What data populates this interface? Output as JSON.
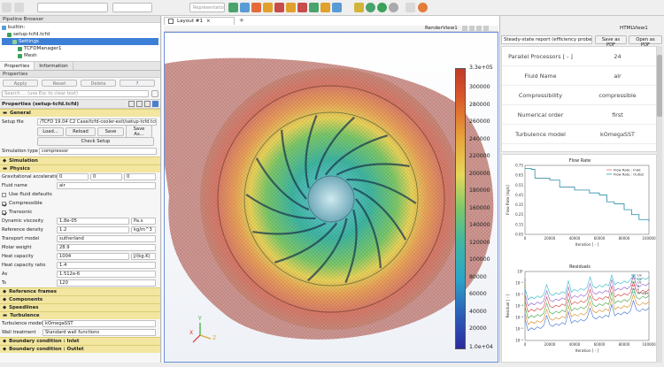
{
  "toolbar": {
    "representation_placeholder": "Representation",
    "icons": [
      "reset-camera-icon",
      "zoom-icon",
      "rotate-icon",
      "axes-icon",
      "camera-icon",
      "filter-icon",
      "slice-icon",
      "clip-icon",
      "glyph-icon",
      "threshold-icon",
      "play-icon",
      "record-icon",
      "settings-icon",
      "python-icon"
    ]
  },
  "pipeline": {
    "title": "Pipeline Browser",
    "items": [
      "builtin:",
      "setup-tcfd.tcfd",
      "Settings",
      "TCFDManager1",
      "Mesh"
    ]
  },
  "properties_panel": {
    "tabs": [
      "Properties",
      "Information"
    ],
    "header": "Properties",
    "apply": "Apply",
    "reset": "Reset",
    "delete": "Delete",
    "help": "?",
    "search_placeholder": "Search ... (use Esc to clear text)",
    "section_title": "Properties (setup-tcfd.tcfd)"
  },
  "general": {
    "title": "General",
    "setup_file_label": "Setup file",
    "setup_file_value": "/TCFD 19.04 C2 Case/tcfd-cooler-exit/setup-tcfd.tcfd",
    "load": "Load...",
    "reload": "Reload",
    "save": "Save",
    "save_as": "Save As...",
    "check_setup": "Check Setup",
    "sim_type_label": "Simulation type",
    "sim_type_value": "compressor"
  },
  "sections": {
    "simulation": "Simulation",
    "physics": "Physics",
    "reference_frames": "Reference frames",
    "components": "Components",
    "speedlines": "Speedlines",
    "turbulence": "Turbulence",
    "bc_inlet": "Boundary condition : Inlet",
    "bc_outlet": "Boundary condition : Outlet"
  },
  "physics": {
    "grav_label": "Gravitational acceleration",
    "grav": [
      "0",
      "0",
      "0"
    ],
    "fluid_label": "Fluid name",
    "fluid_value": "air",
    "use_defaults": "Use fluid defaults",
    "compressible": "Compressible",
    "transonic": "Transonic",
    "viscosity_label": "Dynamic viscosity",
    "viscosity_value": "1.8e-05",
    "viscosity_unit": "Pa.s",
    "density_label": "Reference density",
    "density_value": "1.2",
    "density_unit": "kg/m^3",
    "transport_label": "Transport model",
    "transport_value": "sutherland",
    "molar_label": "Molar weight",
    "molar_value": "28.9",
    "heatcap_label": "Heat capacity",
    "heatcap_value": "1004",
    "heatcap_unit": "J/(kg.K)",
    "ratio_label": "Heat capacity ratio",
    "ratio_value": "1.4",
    "as_label": "As",
    "as_value": "1.512e-6",
    "ts_label": "Ts",
    "ts_value": "120"
  },
  "turbulence": {
    "model_label": "Turbulence model",
    "model_value": "kOmegaSST",
    "wall_label": "Wall treatment",
    "wall_value": "Standard wall functions"
  },
  "layout": {
    "tab": "Layout #1",
    "close": "×",
    "add": "+",
    "render_view": "RenderView1",
    "html_view": "HTMLView1"
  },
  "colorbar": {
    "max_label": "3.3e+05",
    "min_label": "1.0e+04",
    "ticks": [
      "300000",
      "280000",
      "260000",
      "240000",
      "220000",
      "200000",
      "180000",
      "160000",
      "140000",
      "120000",
      "100000",
      "80000",
      "60000",
      "40000",
      "20000"
    ]
  },
  "axes": {
    "x": "X",
    "y": "Y",
    "z": "Z"
  },
  "report": {
    "select_value": "Steady-state report (efficiency probe 1)",
    "save_pdf": "Save as PDF",
    "open_pdf": "Open as PDF",
    "rows": [
      {
        "label": "Parallel Processors [ - ]",
        "value": "24"
      },
      {
        "label": "Fluid Name",
        "value": "air"
      },
      {
        "label": "Compressibility",
        "value": "compressible"
      },
      {
        "label": "Numerical order",
        "value": "first"
      },
      {
        "label": "Turbulence model",
        "value": "kOmegaSST"
      }
    ]
  },
  "chart_data": [
    {
      "type": "line",
      "title": "Flow Rate",
      "xlabel": "Iteration [ - ]",
      "ylabel": "Flow Rate [kg/s]",
      "xlim": [
        0,
        100000
      ],
      "ylim": [
        0.05,
        0.75
      ],
      "xticks": [
        "0",
        "20000",
        "40000",
        "60000",
        "80000",
        "100000"
      ],
      "yticks": [
        "0.75",
        "0.65",
        "0.55",
        "0.45",
        "0.35",
        "0.25",
        "0.15",
        "0.05"
      ],
      "series": [
        {
          "name": "Flow Rate : Inlet",
          "color": "#e07070",
          "points": [
            [
              0,
              0.72
            ],
            [
              5000,
              0.71
            ],
            [
              8000,
              0.62
            ],
            [
              20000,
              0.6
            ],
            [
              28000,
              0.53
            ],
            [
              40000,
              0.5
            ],
            [
              52000,
              0.47
            ],
            [
              60000,
              0.45
            ],
            [
              66000,
              0.38
            ],
            [
              72000,
              0.36
            ],
            [
              80000,
              0.3
            ],
            [
              86000,
              0.25
            ],
            [
              92000,
              0.2
            ],
            [
              100000,
              0.18
            ]
          ]
        },
        {
          "name": "Flow Rate : Outlet",
          "color": "#2a9bb5",
          "points": [
            [
              0,
              0.72
            ],
            [
              5000,
              0.71
            ],
            [
              8000,
              0.62
            ],
            [
              20000,
              0.6
            ],
            [
              28000,
              0.53
            ],
            [
              40000,
              0.5
            ],
            [
              52000,
              0.47
            ],
            [
              60000,
              0.45
            ],
            [
              66000,
              0.38
            ],
            [
              72000,
              0.36
            ],
            [
              80000,
              0.3
            ],
            [
              86000,
              0.25
            ],
            [
              92000,
              0.2
            ],
            [
              100000,
              0.18
            ]
          ]
        }
      ]
    },
    {
      "type": "line",
      "title": "Residuals",
      "xlabel": "Iteration [ - ]",
      "ylabel": "Residual [ - ]",
      "xticks": [
        "0",
        "20000",
        "40000",
        "60000",
        "80000",
        "100000"
      ],
      "yticks": [
        "10⁰",
        "10⁻¹",
        "10⁻²",
        "10⁻³",
        "10⁻⁴",
        "10⁻⁵",
        "10⁻⁶"
      ],
      "series": [
        {
          "name": "Ux",
          "color": "#3b6fd1"
        },
        {
          "name": "Uy",
          "color": "#d8861d"
        },
        {
          "name": "Uz",
          "color": "#3aa244"
        },
        {
          "name": "p",
          "color": "#d83a3a"
        },
        {
          "name": "k",
          "color": "#8a5cc9"
        },
        {
          "name": "omega",
          "color": "#2cb6c4"
        }
      ]
    }
  ]
}
